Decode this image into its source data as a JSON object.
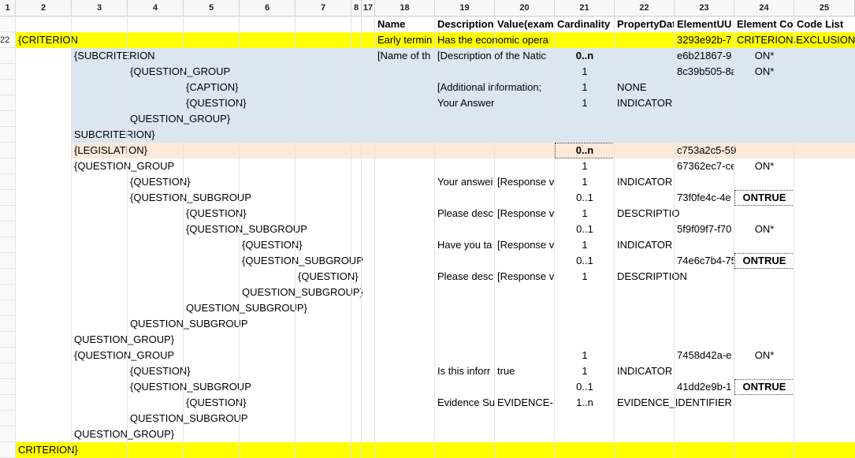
{
  "columns": [
    "1",
    "2",
    "3",
    "4",
    "5",
    "6",
    "7",
    "8",
    "17",
    "18",
    "19",
    "20",
    "21",
    "22",
    "23",
    "24",
    "25"
  ],
  "colors": {
    "yellow": "#ffff00",
    "blue": "#dce6f1",
    "peach": "#fde9d9"
  },
  "rows": [
    {
      "label": "",
      "bg": "",
      "cells": [
        {
          "col": "18",
          "text": "Name",
          "bold": true
        },
        {
          "col": "19",
          "text": "Description",
          "bold": true
        },
        {
          "col": "20",
          "text": "Value(exam",
          "bold": true
        },
        {
          "col": "21",
          "text": "Cardinality",
          "bold": true
        },
        {
          "col": "22",
          "text": "PropertyDat",
          "bold": true
        },
        {
          "col": "23",
          "text": "ElementUU",
          "bold": true
        },
        {
          "col": "24",
          "text": "Element Co",
          "bold": true
        },
        {
          "col": "25",
          "text": "Code List",
          "bold": true
        }
      ]
    },
    {
      "label": "22",
      "bg": "yellow",
      "cells": [
        {
          "col": "2",
          "text": "{CRITERION"
        },
        {
          "col": "18",
          "text": "Early termin"
        },
        {
          "col": "19",
          "text": "Has the economic opera"
        },
        {
          "col": "23",
          "text": "3293e92b-7"
        },
        {
          "col": "24",
          "text": "CRITERION.EXCLUSION.C"
        }
      ]
    },
    {
      "label": "",
      "bg": "blue",
      "cells": [
        {
          "col": "3",
          "text": "{SUBCRITERION"
        },
        {
          "col": "18",
          "text": "[Name of th"
        },
        {
          "col": "19",
          "text": "[Description of the Natic"
        },
        {
          "col": "21",
          "text": "0..n",
          "center": true,
          "bold": true
        },
        {
          "col": "23",
          "text": "e6b21867-9"
        },
        {
          "col": "24",
          "text": "ON*",
          "center": true
        }
      ]
    },
    {
      "label": "",
      "bg": "blue",
      "cells": [
        {
          "col": "4",
          "text": "{QUESTION_GROUP"
        },
        {
          "col": "21",
          "text": "1",
          "center": true
        },
        {
          "col": "23",
          "text": "8c39b505-8a"
        },
        {
          "col": "24",
          "text": "ON*",
          "center": true
        }
      ]
    },
    {
      "label": "",
      "bg": "blue",
      "cells": [
        {
          "col": "5",
          "text": "{CAPTION}"
        },
        {
          "col": "19",
          "text": "[Additional information;"
        },
        {
          "col": "21",
          "text": "1",
          "center": true
        },
        {
          "col": "22",
          "text": "NONE"
        }
      ]
    },
    {
      "label": "",
      "bg": "blue",
      "cells": [
        {
          "col": "5",
          "text": "{QUESTION}"
        },
        {
          "col": "19",
          "text": "Your Answer"
        },
        {
          "col": "21",
          "text": "1",
          "center": true
        },
        {
          "col": "22",
          "text": "INDICATOR"
        }
      ]
    },
    {
      "label": "",
      "bg": "blue",
      "cells": [
        {
          "col": "4",
          "text": "QUESTION_GROUP}"
        }
      ]
    },
    {
      "label": "",
      "bg": "blue",
      "cells": [
        {
          "col": "3",
          "text": "SUBCRITERION}"
        }
      ]
    },
    {
      "label": "",
      "bg": "peach",
      "cells": [
        {
          "col": "3",
          "text": "{LEGISLATION}"
        },
        {
          "col": "21",
          "text": "0..n",
          "center": true,
          "bold": true,
          "boxed": true
        },
        {
          "col": "23",
          "text": "c753a2c5-59"
        }
      ]
    },
    {
      "label": "",
      "bg": "",
      "cells": [
        {
          "col": "3",
          "text": "{QUESTION_GROUP"
        },
        {
          "col": "21",
          "text": "1",
          "center": true
        },
        {
          "col": "23",
          "text": "67362ec7-ce"
        },
        {
          "col": "24",
          "text": "ON*",
          "center": true
        }
      ]
    },
    {
      "label": "",
      "bg": "",
      "cells": [
        {
          "col": "4",
          "text": "{QUESTION}"
        },
        {
          "col": "19",
          "text": "Your answei"
        },
        {
          "col": "20",
          "text": "[Response v"
        },
        {
          "col": "21",
          "text": "1",
          "center": true
        },
        {
          "col": "22",
          "text": "INDICATOR"
        }
      ]
    },
    {
      "label": "",
      "bg": "",
      "cells": [
        {
          "col": "4",
          "text": "{QUESTION_SUBGROUP"
        },
        {
          "col": "21",
          "text": "0..1",
          "center": true
        },
        {
          "col": "23",
          "text": "73f0fe4c-4e"
        },
        {
          "col": "24",
          "text": "ONTRUE",
          "center": true,
          "bold": true,
          "boxed": true
        }
      ]
    },
    {
      "label": "",
      "bg": "",
      "cells": [
        {
          "col": "5",
          "text": "{QUESTION}"
        },
        {
          "col": "19",
          "text": "Please desc"
        },
        {
          "col": "20",
          "text": "[Response v"
        },
        {
          "col": "21",
          "text": "1",
          "center": true
        },
        {
          "col": "22",
          "text": "DESCRIPTIO"
        }
      ]
    },
    {
      "label": "",
      "bg": "",
      "cells": [
        {
          "col": "5",
          "text": "{QUESTION_SUBGROUP"
        },
        {
          "col": "21",
          "text": "0..1",
          "center": true
        },
        {
          "col": "23",
          "text": "5f9f09f7-f70"
        },
        {
          "col": "24",
          "text": "ON*",
          "center": true
        }
      ]
    },
    {
      "label": "",
      "bg": "",
      "cells": [
        {
          "col": "6",
          "text": "{QUESTION}"
        },
        {
          "col": "19",
          "text": "Have you ta"
        },
        {
          "col": "20",
          "text": "[Response v"
        },
        {
          "col": "21",
          "text": "1",
          "center": true
        },
        {
          "col": "22",
          "text": "INDICATOR"
        }
      ]
    },
    {
      "label": "",
      "bg": "",
      "cells": [
        {
          "col": "6",
          "text": "{QUESTION_SUBGROUP"
        },
        {
          "col": "21",
          "text": "0..1",
          "center": true
        },
        {
          "col": "23",
          "text": "74e6c7b4-75"
        },
        {
          "col": "24",
          "text": "ONTRUE",
          "center": true,
          "bold": true,
          "boxed": true
        }
      ]
    },
    {
      "label": "",
      "bg": "",
      "cells": [
        {
          "col": "7",
          "text": "{QUESTION}"
        },
        {
          "col": "19",
          "text": "Please desc"
        },
        {
          "col": "20",
          "text": "[Response v"
        },
        {
          "col": "21",
          "text": "1",
          "center": true
        },
        {
          "col": "22",
          "text": "DESCRIPTION"
        }
      ]
    },
    {
      "label": "",
      "bg": "",
      "cells": [
        {
          "col": "6",
          "text": "QUESTION_SUBGROUP}"
        }
      ]
    },
    {
      "label": "",
      "bg": "",
      "cells": [
        {
          "col": "5",
          "text": "QUESTION_SUBGROUP}"
        }
      ]
    },
    {
      "label": "",
      "bg": "",
      "cells": [
        {
          "col": "4",
          "text": "QUESTION_SUBGROUP"
        }
      ]
    },
    {
      "label": "",
      "bg": "",
      "cells": [
        {
          "col": "3",
          "text": "QUESTION_GROUP}"
        }
      ]
    },
    {
      "label": "",
      "bg": "",
      "cells": [
        {
          "col": "3",
          "text": "{QUESTION_GROUP"
        },
        {
          "col": "21",
          "text": "1",
          "center": true
        },
        {
          "col": "23",
          "text": "7458d42a-e"
        },
        {
          "col": "24",
          "text": "ON*",
          "center": true
        }
      ]
    },
    {
      "label": "",
      "bg": "",
      "cells": [
        {
          "col": "4",
          "text": "{QUESTION}"
        },
        {
          "col": "19",
          "text": "Is this inforr"
        },
        {
          "col": "20",
          "text": "true"
        },
        {
          "col": "21",
          "text": "1",
          "center": true
        },
        {
          "col": "22",
          "text": "INDICATOR"
        }
      ]
    },
    {
      "label": "",
      "bg": "",
      "cells": [
        {
          "col": "4",
          "text": "{QUESTION_SUBGROUP"
        },
        {
          "col": "21",
          "text": "0..1",
          "center": true
        },
        {
          "col": "23",
          "text": "41dd2e9b-1"
        },
        {
          "col": "24",
          "text": "ONTRUE",
          "center": true,
          "bold": true,
          "boxed": true
        }
      ]
    },
    {
      "label": "",
      "bg": "",
      "cells": [
        {
          "col": "5",
          "text": "{QUESTION}"
        },
        {
          "col": "19",
          "text": "Evidence Su"
        },
        {
          "col": "20",
          "text": "EVIDENCE-II"
        },
        {
          "col": "21",
          "text": "1..n",
          "center": true
        },
        {
          "col": "22",
          "text": "EVIDENCE_IDENTIFIER"
        }
      ]
    },
    {
      "label": "",
      "bg": "",
      "cells": [
        {
          "col": "4",
          "text": "QUESTION_SUBGROUP"
        }
      ]
    },
    {
      "label": "",
      "bg": "",
      "cells": [
        {
          "col": "3",
          "text": "QUESTION_GROUP}"
        }
      ]
    },
    {
      "label": "",
      "bg": "yellow",
      "cells": [
        {
          "col": "2",
          "text": "CRITERION}"
        }
      ]
    }
  ]
}
